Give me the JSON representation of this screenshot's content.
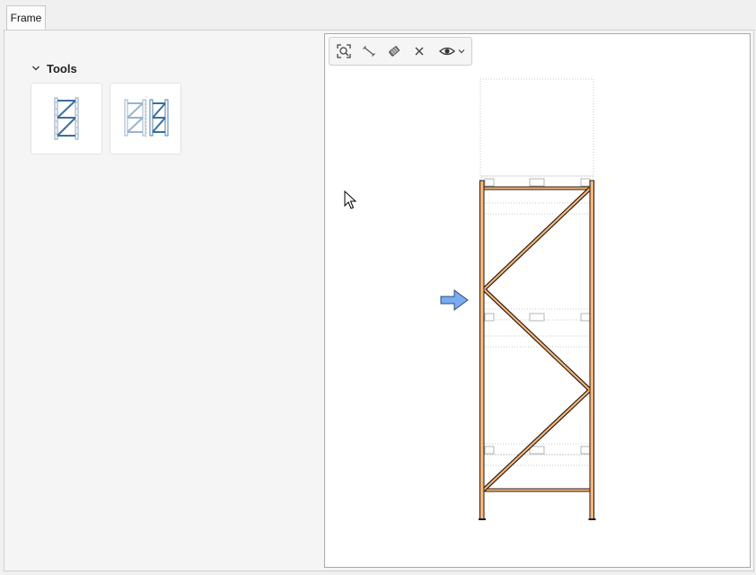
{
  "tabs": [
    {
      "label": "Frame",
      "active": true
    }
  ],
  "tools_panel": {
    "header": "Tools",
    "expanded": true,
    "items": [
      {
        "icon": "single-frame-icon"
      },
      {
        "icon": "double-frame-icon"
      }
    ]
  },
  "toolbar": {
    "buttons": [
      {
        "icon": "zoom-fit-icon"
      },
      {
        "icon": "measure-icon"
      },
      {
        "icon": "eraser-icon"
      },
      {
        "icon": "close-icon"
      },
      {
        "icon": "eye-icon",
        "has_dropdown": true
      }
    ]
  },
  "colors": {
    "upright_fill": "#f5b77a",
    "upright_stroke": "#2a1a10",
    "brace_fill": "#f5b77a",
    "selection_arrow": "#7aaaf0",
    "icon_blue": "#3b6f9f",
    "dotted_guides": "#c8c8c8"
  }
}
